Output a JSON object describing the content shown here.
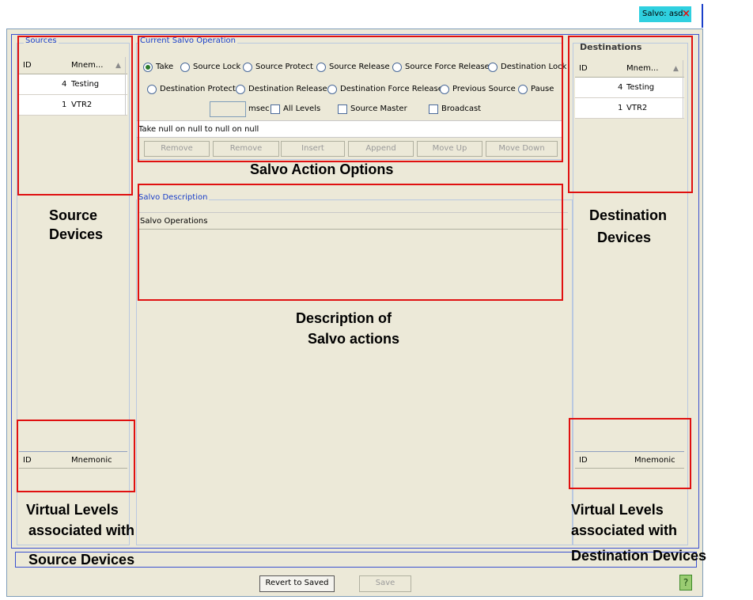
{
  "tab": {
    "label": "Salvo: asd",
    "close": "×"
  },
  "sources": {
    "title": "Sources",
    "columns": [
      "ID",
      "Mnem..."
    ],
    "rows": [
      {
        "id": "4",
        "name": "Testing"
      },
      {
        "id": "1",
        "name": "VTR2"
      }
    ],
    "levels_columns": [
      "ID",
      "Mnemonic"
    ]
  },
  "operation": {
    "title": "Current Salvo Operation",
    "radios_row1": [
      "Take",
      "Source Lock",
      "Source Protect",
      "Source Release",
      "Source Force Release",
      "Destination Lock"
    ],
    "radios_row2": [
      "Destination Protect",
      "Destination Release",
      "Destination Force Release",
      "Previous Source",
      "Pause"
    ],
    "selected": "Take",
    "msec_label": "msec",
    "all_levels": "All Levels",
    "source_master": "Source Master",
    "broadcast": "Broadcast",
    "summary": "Take null on null to null on null",
    "buttons": [
      "Remove",
      "Remove",
      "Insert",
      "Append",
      "Move Up",
      "Move Down"
    ]
  },
  "description": {
    "title": "Salvo Description",
    "column": "Salvo Operations"
  },
  "destinations": {
    "title": "Destinations",
    "columns": [
      "ID",
      "Mnem..."
    ],
    "rows": [
      {
        "id": "4",
        "name": "Testing"
      },
      {
        "id": "1",
        "name": "VTR2"
      }
    ],
    "levels_columns": [
      "ID",
      "Mnemonic"
    ]
  },
  "footer": {
    "revert": "Revert to Saved",
    "save": "Save",
    "help": "?"
  },
  "annotations": {
    "action_options": "Salvo Action Options",
    "source_devices_1": "Source",
    "source_devices_2": "Devices",
    "destination_devices_1": "Destination",
    "destination_devices_2": "Devices",
    "description_1": "Description of",
    "description_2": "Salvo actions",
    "src_levels_1": "Virtual Levels",
    "src_levels_2": "associated with",
    "src_levels_3": "Source Devices",
    "dst_levels_1": "Virtual Levels",
    "dst_levels_2": "associated with",
    "dst_levels_3": "Destination Devices"
  }
}
